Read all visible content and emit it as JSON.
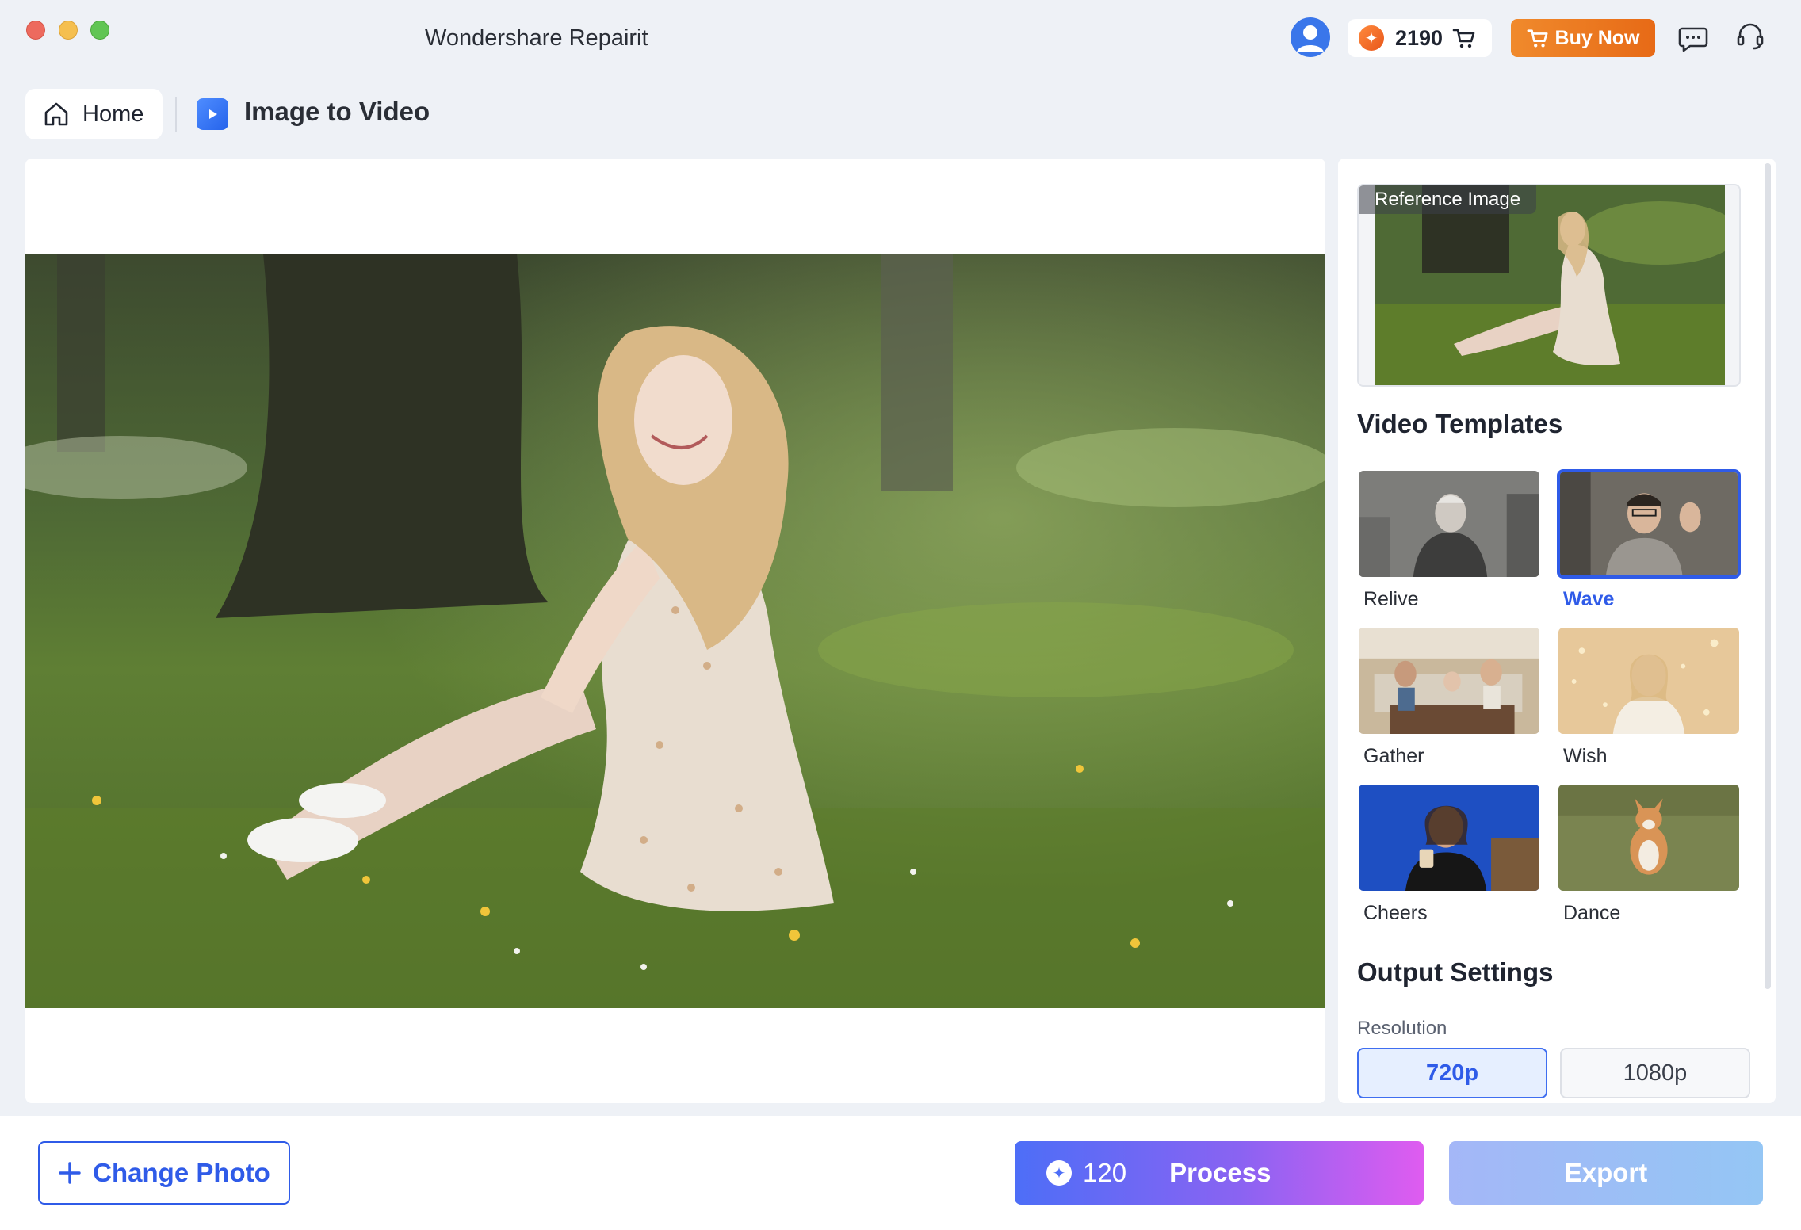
{
  "window": {
    "title": "Wondershare Repairit"
  },
  "header": {
    "credits": "2190",
    "buy_label": "Buy Now",
    "icons": [
      "avatar-icon",
      "coin-icon",
      "cart-icon",
      "chat-icon",
      "headset-icon"
    ]
  },
  "breadcrumb": {
    "home_label": "Home",
    "page_title": "Image to Video"
  },
  "side_panel": {
    "reference_label": "Reference Image",
    "templates_heading": "Video Templates",
    "templates": [
      {
        "label": "Relive",
        "selected": false
      },
      {
        "label": "Wave",
        "selected": true
      },
      {
        "label": "Gather",
        "selected": false
      },
      {
        "label": "Wish",
        "selected": false
      },
      {
        "label": "Cheers",
        "selected": false
      },
      {
        "label": "Dance",
        "selected": false
      }
    ],
    "output_heading": "Output Settings",
    "resolution_label": "Resolution",
    "resolutions": [
      "720p",
      "1080p"
    ],
    "resolution_selected": "720p"
  },
  "bottom": {
    "change_photo_label": "Change Photo",
    "process_cost": "120",
    "process_label": "Process",
    "export_label": "Export"
  },
  "colors": {
    "accent": "#2f5be8",
    "buy_orange": "#e76a16",
    "process_start": "#4d6ef7",
    "process_end": "#df5cf0",
    "background": "#eef1f6"
  }
}
